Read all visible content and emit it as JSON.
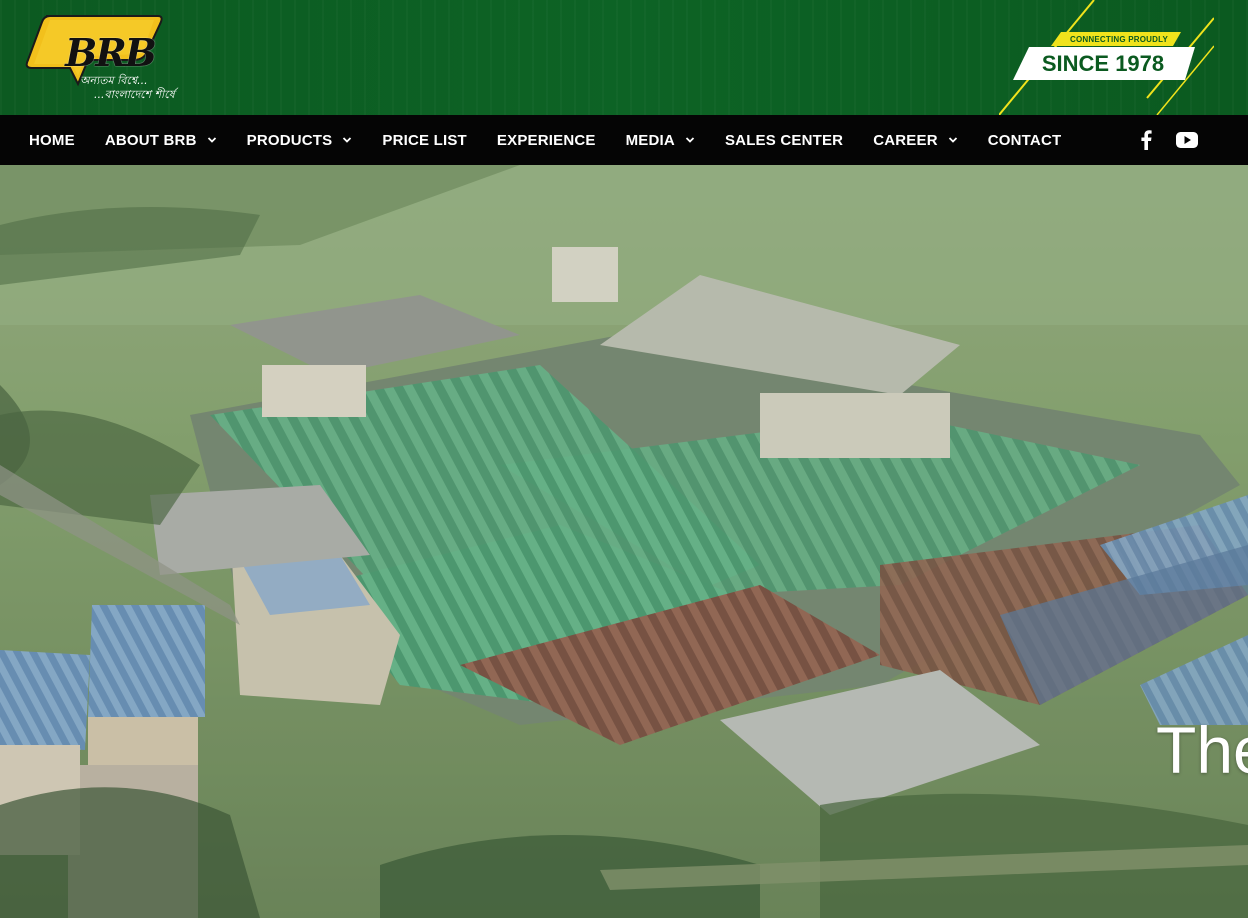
{
  "brand": {
    "logo_text": "BRB",
    "tagline_line1": "অন্যতম বিশ্বে...",
    "tagline_line2": "...বাংলাদেশে শীর্ষে",
    "badge_small": "CONNECTING PROUDLY",
    "badge_big": "SINCE 1978"
  },
  "nav": {
    "items": [
      {
        "label": "HOME",
        "dropdown": false
      },
      {
        "label": "ABOUT BRB",
        "dropdown": true
      },
      {
        "label": "PRODUCTS",
        "dropdown": true
      },
      {
        "label": "PRICE LIST",
        "dropdown": false
      },
      {
        "label": "EXPERIENCE",
        "dropdown": false
      },
      {
        "label": "MEDIA",
        "dropdown": true
      },
      {
        "label": "SALES CENTER",
        "dropdown": false
      },
      {
        "label": "CAREER",
        "dropdown": true
      },
      {
        "label": "CONTACT",
        "dropdown": false
      }
    ],
    "social": [
      {
        "icon": "facebook-icon"
      },
      {
        "icon": "youtube-icon"
      }
    ]
  },
  "hero": {
    "heading": "The"
  },
  "colors": {
    "header_green": "#0c5a21",
    "nav_bg": "#050505",
    "badge_yellow": "#f0e31c",
    "logo_gold": "#f2c01c"
  }
}
